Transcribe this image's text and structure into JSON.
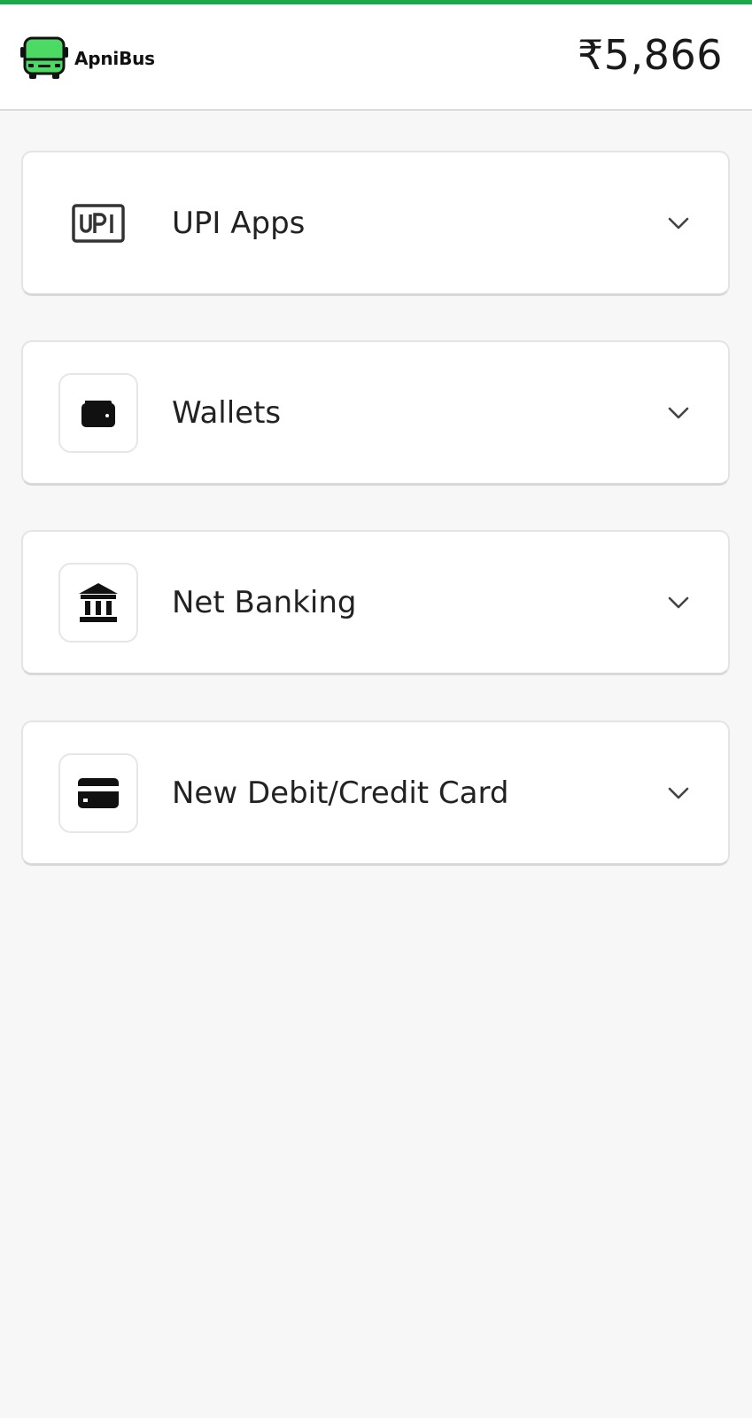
{
  "app": {
    "brand_name": "ApniBus",
    "amount": "₹5,866"
  },
  "payment_options": [
    {
      "label": "UPI Apps",
      "icon": "upi-icon"
    },
    {
      "label": "Wallets",
      "icon": "wallet-icon"
    },
    {
      "label": "Net Banking",
      "icon": "bank-icon"
    },
    {
      "label": "New Debit/Credit Card",
      "icon": "credit-card-icon"
    }
  ],
  "colors": {
    "accent": "#1aa84a",
    "logo_green": "#4cd964",
    "background": "#f7f7f7"
  }
}
